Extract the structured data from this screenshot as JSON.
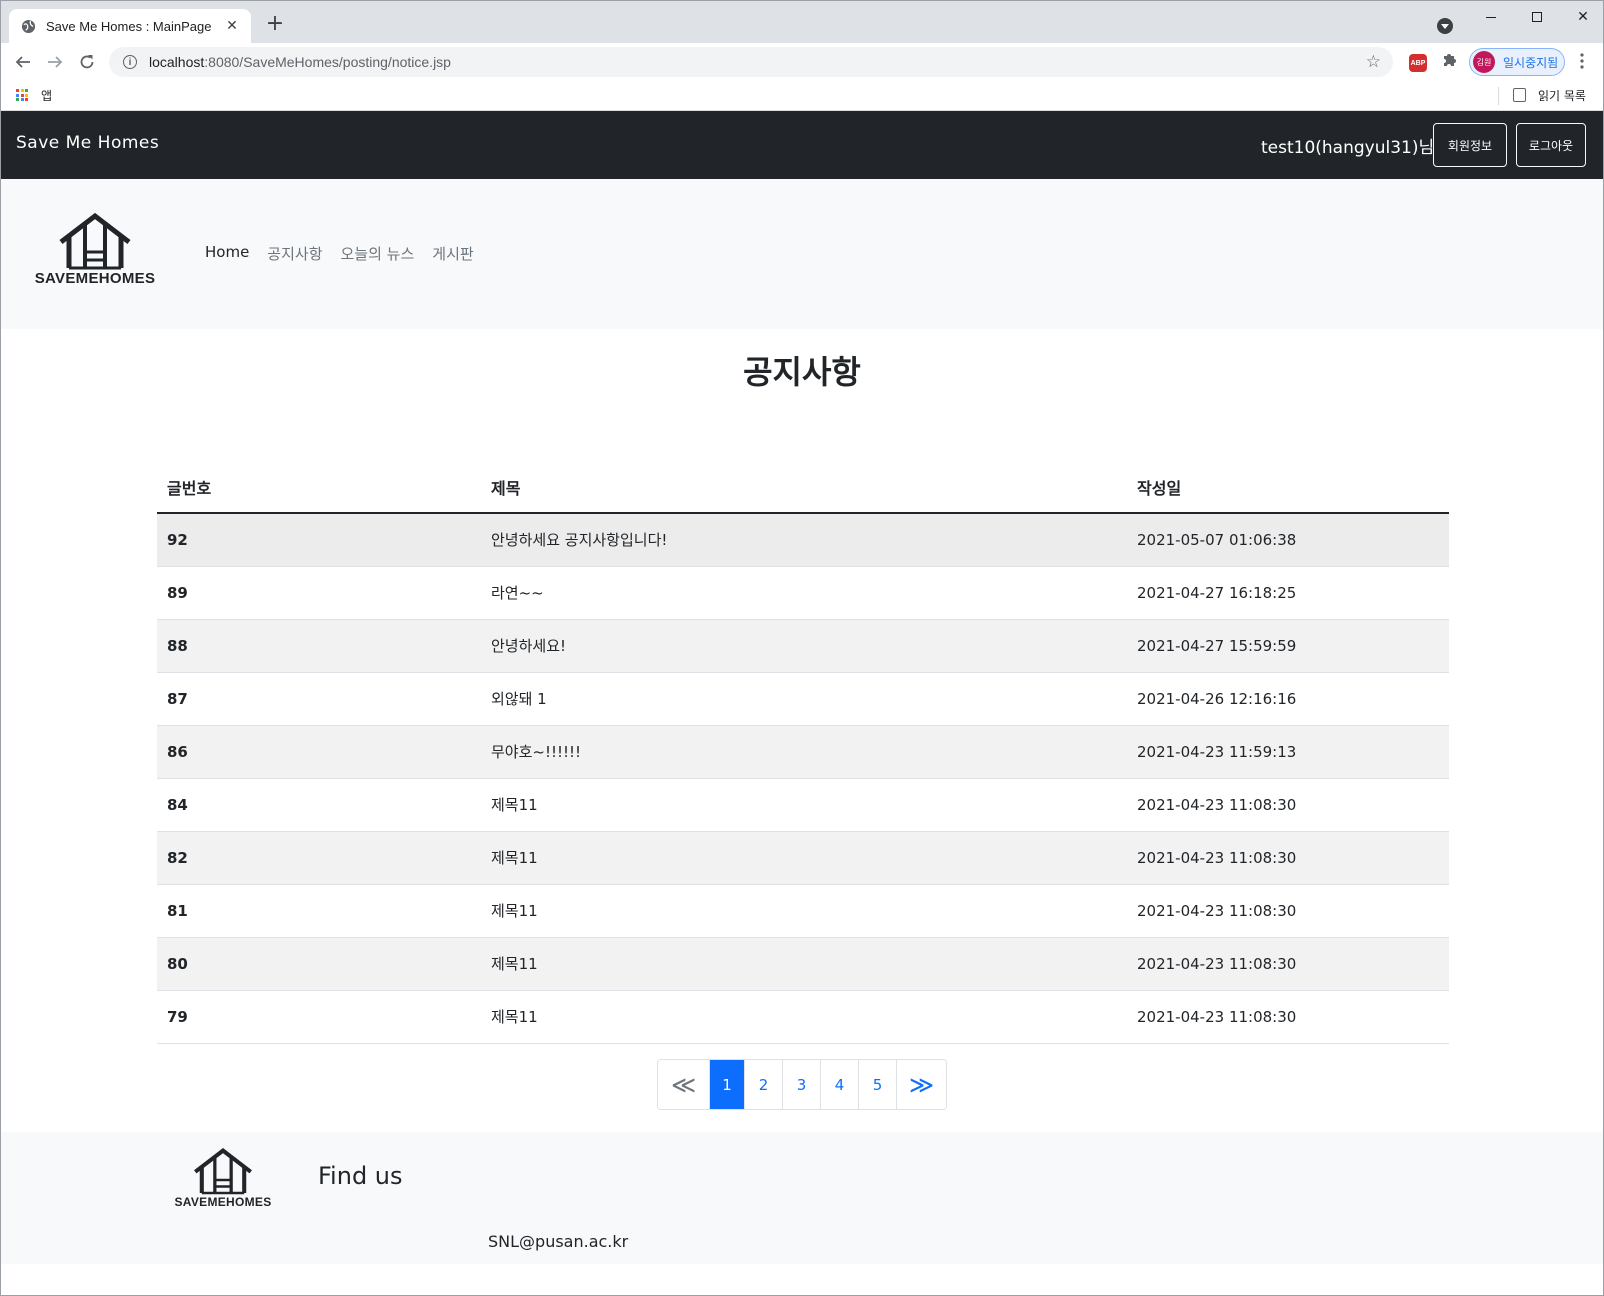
{
  "browser": {
    "tab_title": "Save Me Homes : MainPage",
    "url_host": "localhost",
    "url_path": ":8080/SaveMeHomes/posting/notice.jsp",
    "profile_avatar": "김원",
    "profile_label": "일시중지됨",
    "apps_label": "앱",
    "reading_list_label": "읽기 목록"
  },
  "header": {
    "brand": "Save Me Homes",
    "user_greeting": "test10(hangyul31)님",
    "member_info_button": "회원정보",
    "logout_button": "로그아웃"
  },
  "nav": {
    "logo_text": "SAVEMEHOMES",
    "links": [
      {
        "label": "Home",
        "active": true
      },
      {
        "label": "공지사항",
        "active": false
      },
      {
        "label": "오늘의 뉴스",
        "active": false
      },
      {
        "label": "게시판",
        "active": false
      }
    ]
  },
  "notice": {
    "title": "공지사항",
    "columns": [
      "글번호",
      "제목",
      "작성일"
    ],
    "rows": [
      {
        "num": "92",
        "title": "안녕하세요 공지사항입니다!",
        "date": "2021-05-07 01:06:38"
      },
      {
        "num": "89",
        "title": "라연~~",
        "date": "2021-04-27 16:18:25"
      },
      {
        "num": "88",
        "title": "안녕하세요!",
        "date": "2021-04-27 15:59:59"
      },
      {
        "num": "87",
        "title": "외않돼 1",
        "date": "2021-04-26 12:16:16"
      },
      {
        "num": "86",
        "title": "무야호~!!!!!!",
        "date": "2021-04-23 11:59:13"
      },
      {
        "num": "84",
        "title": "제목11",
        "date": "2021-04-23 11:08:30"
      },
      {
        "num": "82",
        "title": "제목11",
        "date": "2021-04-23 11:08:30"
      },
      {
        "num": "81",
        "title": "제목11",
        "date": "2021-04-23 11:08:30"
      },
      {
        "num": "80",
        "title": "제목11",
        "date": "2021-04-23 11:08:30"
      },
      {
        "num": "79",
        "title": "제목11",
        "date": "2021-04-23 11:08:30"
      }
    ]
  },
  "pagination": {
    "prev": "≪",
    "pages": [
      "1",
      "2",
      "3",
      "4",
      "5"
    ],
    "current": "1",
    "next": "≫"
  },
  "footer": {
    "logo_text": "SAVEMEHOMES",
    "find_us": "Find us",
    "email": "SNL@pusan.ac.kr"
  },
  "colors": {
    "topbar": "#212529",
    "nav_bg": "#f8f9fa",
    "accent": "#0d6efd"
  }
}
